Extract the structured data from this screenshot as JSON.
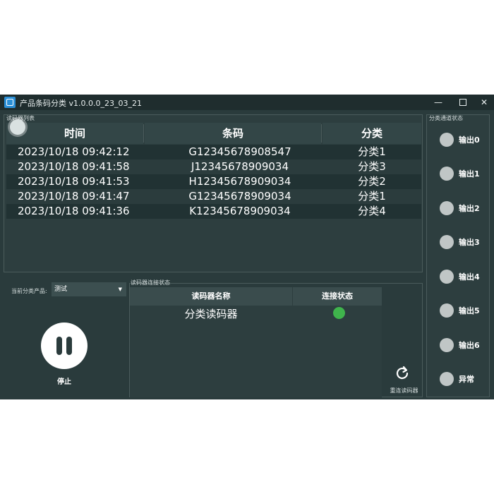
{
  "titlebar": {
    "title": "产品条码分类 v1.0.0.0_23_03_21",
    "minimize": "—",
    "close": "✕"
  },
  "reader_list": {
    "title": "读码器列表",
    "columns": [
      "时间",
      "条码",
      "分类"
    ],
    "rows": [
      {
        "time": "2023/10/18 09:42:12",
        "code": "G12345678908547",
        "category": "分类1"
      },
      {
        "time": "2023/10/18 09:41:58",
        "code": "J12345678909034",
        "category": "分类3"
      },
      {
        "time": "2023/10/18 09:41:53",
        "code": "H12345678909034",
        "category": "分类2"
      },
      {
        "time": "2023/10/18 09:41:47",
        "code": "G12345678909034",
        "category": "分类1"
      },
      {
        "time": "2023/10/18 09:41:36",
        "code": "K12345678909034",
        "category": "分类4"
      }
    ]
  },
  "category": {
    "label": "当前分类产品:",
    "selected": "测试",
    "arrow": "▼"
  },
  "stop": {
    "label": "停止"
  },
  "connection": {
    "title": "读码器连接状态",
    "columns": [
      "读码器名称",
      "连接状态"
    ],
    "reader_name": "分类读码器",
    "status_color": "#3fb44c",
    "reconnect_label": "重连读码器"
  },
  "channels": {
    "title": "分类通道状态",
    "items": [
      "输出0",
      "输出1",
      "输出2",
      "输出3",
      "输出4",
      "输出5",
      "输出6",
      "异常"
    ]
  }
}
